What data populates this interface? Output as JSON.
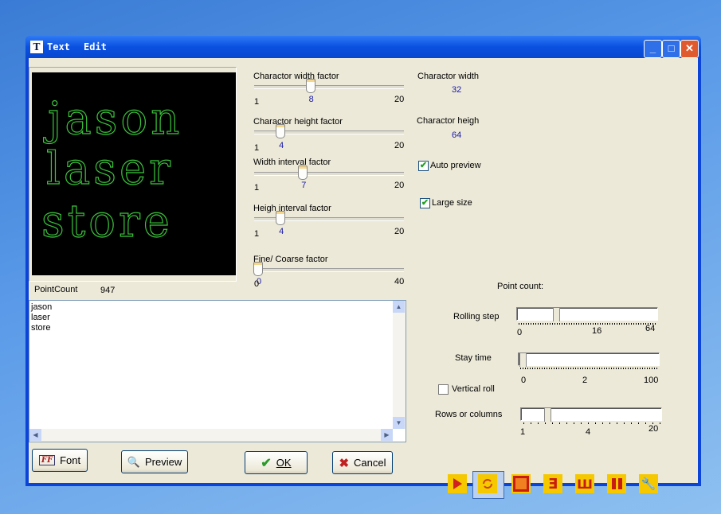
{
  "window": {
    "icon_letter": "T",
    "menu": [
      "Text",
      "Edit"
    ],
    "controls": {
      "minimize": "_",
      "maximize": "□",
      "close": "✕"
    }
  },
  "preview": {
    "lines": [
      "jason",
      "laser",
      "store"
    ],
    "stroke_color": "#3bc43b",
    "point_count_label": "PointCount",
    "point_count": "947"
  },
  "sliders": [
    {
      "label": "Charactor width  factor",
      "min": "1",
      "value": "8",
      "max": "20"
    },
    {
      "label": "Charactor height factor",
      "min": "1",
      "value": "4",
      "max": "20"
    },
    {
      "label": "Width interval factor",
      "min": "1",
      "value": "7",
      "max": "20"
    },
    {
      "label": "Heigh interval factor",
      "min": "1",
      "value": "4",
      "max": "20"
    },
    {
      "label": "Fine/ Coarse  factor",
      "min": "0",
      "value": "0",
      "max": "40"
    }
  ],
  "info": {
    "width_label": "Charactor width",
    "width_value": "32",
    "height_label": "Charactor heigh",
    "height_value": "64"
  },
  "options": {
    "auto_preview": {
      "label": "Auto preview",
      "checked": true
    },
    "large_size": {
      "label": "Large size",
      "checked": true
    },
    "vertical_roll": {
      "label": "Vertical roll",
      "checked": false
    }
  },
  "text_input": {
    "value": "jason\nlaser\nstore"
  },
  "buttons": {
    "font": "Font",
    "preview": "Preview",
    "ok": "OK",
    "cancel": "Cancel"
  },
  "roll": {
    "point_count_label": "Point count:",
    "rolling_step": {
      "label": "Rolling step",
      "min": "0",
      "value": "16",
      "max": "64"
    },
    "stay_time": {
      "label": "Stay time",
      "min": "0",
      "value": "2",
      "max": "100"
    },
    "rows_columns": {
      "label": "Rows or columns",
      "min": "1",
      "value": "4",
      "max": "20"
    }
  },
  "toolbar": [
    "play-icon",
    "loop-icon",
    "stop-icon",
    "scroll-up-icon",
    "scroll-left-icon",
    "pause-icon",
    "settings-wrench-icon"
  ],
  "colors": {
    "accent": "#f5c800",
    "value_text": "#1a1aa8"
  }
}
